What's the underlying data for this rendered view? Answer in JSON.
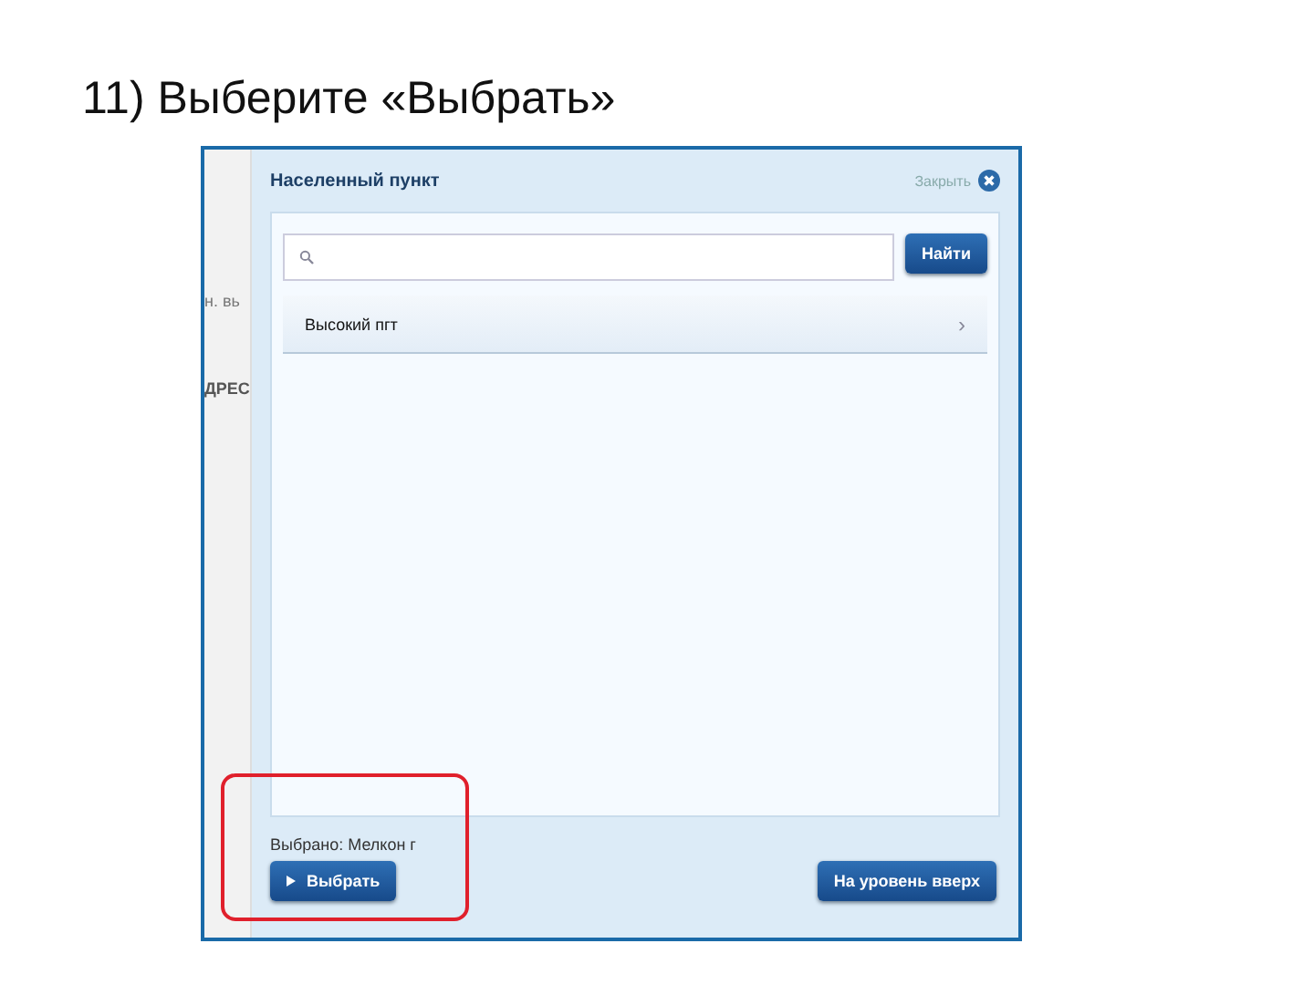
{
  "slide": {
    "title": "11) Выберите «Выбрать»"
  },
  "background_page": {
    "fragments": [
      "н. вь",
      "ДРЕС"
    ]
  },
  "dialog": {
    "title": "Населенный пункт",
    "close_label": "Закрыть",
    "search": {
      "button": "Найти"
    },
    "items": [
      {
        "label": "Высокий пгт",
        "chevron": "›"
      }
    ],
    "selection": "Выбрано: Мелкон г",
    "select_button": {
      "label": "Выбрать",
      "highlighted": true
    },
    "up_button": "На уровень вверх"
  }
}
